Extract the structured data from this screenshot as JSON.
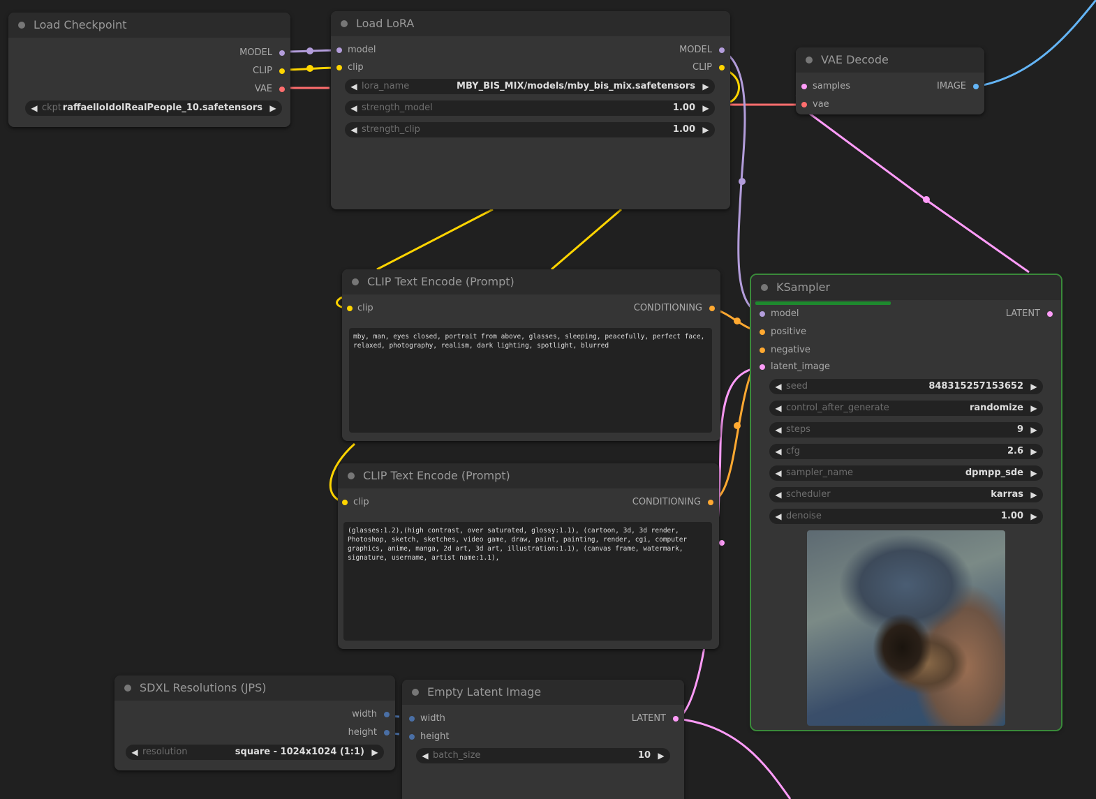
{
  "colors": {
    "model": "#b39ddb",
    "clip": "#ffd500",
    "vae": "#ff6e6e",
    "image": "#64b5f6",
    "latent": "#ff9cf9",
    "conditioning": "#ffa931",
    "int": "#4a6fa5"
  },
  "load_checkpoint": {
    "title": "Load Checkpoint",
    "out_model": "MODEL",
    "out_clip": "CLIP",
    "out_vae": "VAE",
    "ckpt_name_label": "ckpt",
    "ckpt_name_value": "raffaelloIdolRealPeople_10.safetensors"
  },
  "load_lora": {
    "title": "Load LoRA",
    "in_model": "model",
    "in_clip": "clip",
    "out_model": "MODEL",
    "out_clip": "CLIP",
    "lora_name_label": "lora_name",
    "lora_name_value": "MBY_BIS_MIX/models/mby_bis_mix.safetensors",
    "strength_model_label": "strength_model",
    "strength_model_value": "1.00",
    "strength_clip_label": "strength_clip",
    "strength_clip_value": "1.00"
  },
  "vae_decode": {
    "title": "VAE Decode",
    "in_samples": "samples",
    "in_vae": "vae",
    "out_image": "IMAGE"
  },
  "clip_text_pos": {
    "title": "CLIP Text Encode (Prompt)",
    "in_clip": "clip",
    "out_conditioning": "CONDITIONING",
    "text": "mby, man, eyes closed, portrait from above, glasses, sleeping, peacefully, perfect face, relaxed, photography, realism, dark lighting, spotlight, blurred"
  },
  "clip_text_neg": {
    "title": "CLIP Text Encode (Prompt)",
    "in_clip": "clip",
    "out_conditioning": "CONDITIONING",
    "text": "(glasses:1.2),(high contrast, over saturated, glossy:1.1), (cartoon, 3d, 3d render, Photoshop, sketch, sketches, video game, draw, paint, painting, render, cgi, computer graphics, anime, manga, 2d art, 3d art, illustration:1.1), (canvas frame, watermark, signature, username, artist name:1.1),"
  },
  "ksampler": {
    "title": "KSampler",
    "progress": 0.45,
    "in_model": "model",
    "in_positive": "positive",
    "in_negative": "negative",
    "in_latent": "latent_image",
    "out_latent": "LATENT",
    "widgets": [
      {
        "name": "seed",
        "value": "848315257153652"
      },
      {
        "name": "control_after_generate",
        "value": "randomize"
      },
      {
        "name": "steps",
        "value": "9"
      },
      {
        "name": "cfg",
        "value": "2.6"
      },
      {
        "name": "sampler_name",
        "value": "dpmpp_sde"
      },
      {
        "name": "scheduler",
        "value": "karras"
      },
      {
        "name": "denoise",
        "value": "1.00"
      }
    ]
  },
  "sdxl_res": {
    "title": "SDXL Resolutions (JPS)",
    "out_width": "width",
    "out_height": "height",
    "resolution_label": "resolution",
    "resolution_value": "square - 1024x1024 (1:1)"
  },
  "empty_latent": {
    "title": "Empty Latent Image",
    "in_width": "width",
    "in_height": "height",
    "out_latent": "LATENT",
    "batch_size_label": "batch_size",
    "batch_size_value": "10"
  }
}
